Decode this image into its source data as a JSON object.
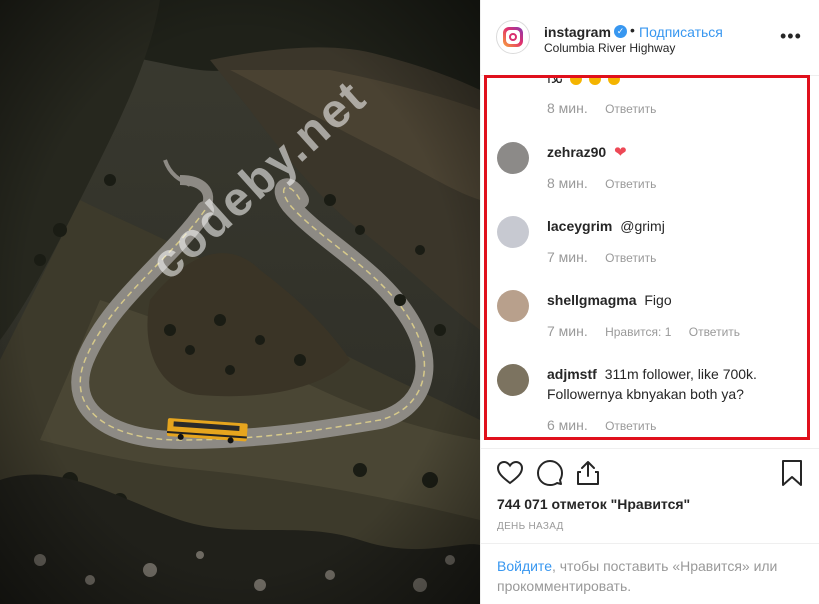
{
  "post": {
    "username": "instagram",
    "verified_icon": "verified-badge-icon",
    "separator": "•",
    "follow_label": "Подписаться",
    "location": "Columbia River Highway",
    "more_icon": "more-options-icon"
  },
  "comments": {
    "partial_text": "تلآا",
    "partial_meta": {
      "time": "8 мин.",
      "reply": "Ответить"
    },
    "items": [
      {
        "username": "zehraz90",
        "text": "",
        "emoji": "❤",
        "time": "8 мин.",
        "likes": "",
        "reply": "Ответить",
        "avatar_color": "#8c8a88"
      },
      {
        "username": "laceygrim",
        "text": "@grimj",
        "emoji": "",
        "time": "7 мин.",
        "likes": "",
        "reply": "Ответить",
        "avatar_color": "#c7c9d1"
      },
      {
        "username": "shellgmagma",
        "text": "Figo",
        "emoji": "",
        "time": "7 мин.",
        "likes": "Нравится: 1",
        "reply": "Ответить",
        "avatar_color": "#b8a08c"
      },
      {
        "username": "adjmstf",
        "text": "311m follower, like 700k. Followernya kbnyakan both ya?",
        "emoji": "",
        "time": "6 мин.",
        "likes": "",
        "reply": "Ответить",
        "avatar_color": "#7c7360"
      }
    ]
  },
  "actions": {
    "like_icon": "heart-outline-icon",
    "comment_icon": "comment-icon",
    "share_icon": "share-icon",
    "save_icon": "bookmark-icon"
  },
  "stats": {
    "likes_text": "744 071 отметок \"Нравится\"",
    "date_text": "ДЕНЬ НАЗАД"
  },
  "login_prompt": {
    "link": "Войдите",
    "rest": ", чтобы поставить «Нравится» или прокомментировать."
  },
  "watermark": "codeby.net",
  "colors": {
    "link": "#3897f0",
    "highlight": "#e0101c",
    "heart": "#ed4956"
  }
}
